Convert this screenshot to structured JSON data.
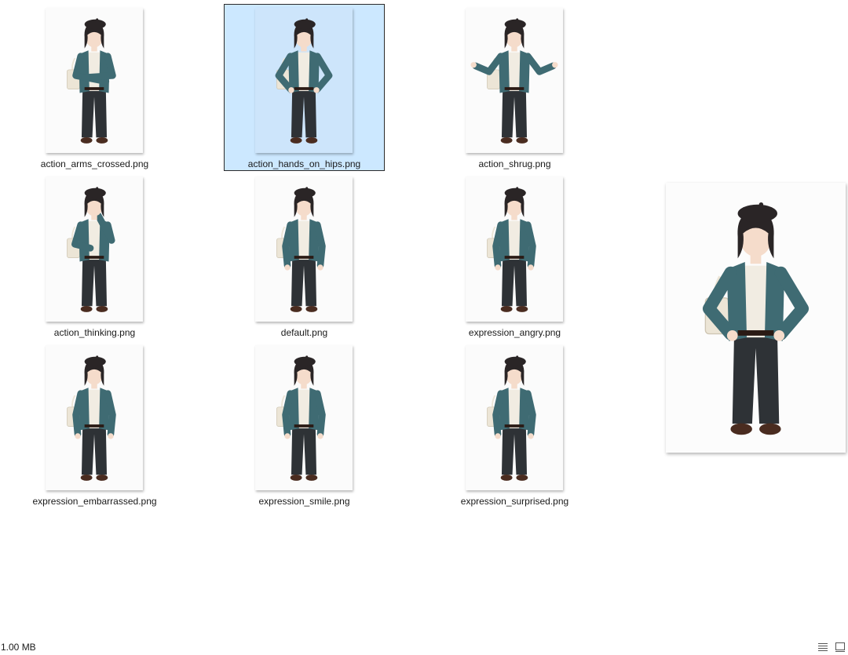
{
  "files": [
    {
      "name": "action_arms_crossed.png",
      "selected": false,
      "pose": "arms"
    },
    {
      "name": "action_hands_on_hips.png",
      "selected": true,
      "pose": "hips"
    },
    {
      "name": "action_shrug.png",
      "selected": false,
      "pose": "shrug"
    },
    {
      "name": "action_thinking.png",
      "selected": false,
      "pose": "thinking"
    },
    {
      "name": "default.png",
      "selected": false,
      "pose": "default"
    },
    {
      "name": "expression_angry.png",
      "selected": false,
      "pose": "default"
    },
    {
      "name": "expression_embarrassed.png",
      "selected": false,
      "pose": "default"
    },
    {
      "name": "expression_smile.png",
      "selected": false,
      "pose": "default"
    },
    {
      "name": "expression_surprised.png",
      "selected": false,
      "pose": "default"
    }
  ],
  "status": {
    "size": "1.00 MB"
  },
  "view_buttons": [
    {
      "name": "details-view-icon"
    },
    {
      "name": "large-icons-view-icon"
    }
  ],
  "colors": {
    "selection": "#cce8ff",
    "cardigan": "#3f6b73",
    "pants": "#2e3236",
    "shirt": "#f1ece2",
    "hair": "#2a2526",
    "skin": "#f5dccb",
    "shoes": "#4a2c20",
    "bag": "#ece5d6"
  }
}
